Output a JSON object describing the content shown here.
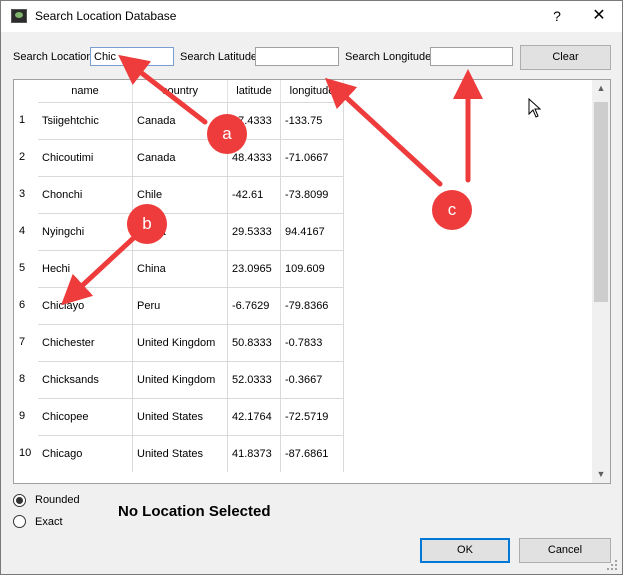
{
  "window": {
    "title": "Search Location Database",
    "help_glyph": "?",
    "close_glyph": "✕"
  },
  "search": {
    "location_label": "Search Location",
    "location_value": "Chic",
    "latitude_label": "Search Latitude",
    "latitude_value": "",
    "longitude_label": "Search Longitude",
    "longitude_value": "",
    "clear_label": "Clear"
  },
  "table": {
    "columns": [
      "name",
      "country",
      "latitude",
      "longitude"
    ],
    "rows": [
      {
        "n": "1",
        "name": "Tsiigehtchic",
        "country": "Canada",
        "latitude": "67.4333",
        "longitude": "-133.75"
      },
      {
        "n": "2",
        "name": "Chicoutimi",
        "country": "Canada",
        "latitude": "48.4333",
        "longitude": "-71.0667"
      },
      {
        "n": "3",
        "name": "Chonchi",
        "country": "Chile",
        "latitude": "-42.61",
        "longitude": "-73.8099"
      },
      {
        "n": "4",
        "name": "Nyingchi",
        "country": "China",
        "latitude": "29.5333",
        "longitude": "94.4167"
      },
      {
        "n": "5",
        "name": "Hechi",
        "country": "China",
        "latitude": "23.0965",
        "longitude": "109.609"
      },
      {
        "n": "6",
        "name": "Chiclayo",
        "country": "Peru",
        "latitude": "-6.7629",
        "longitude": "-79.8366"
      },
      {
        "n": "7",
        "name": "Chichester",
        "country": "United Kingdom",
        "latitude": "50.8333",
        "longitude": "-0.7833"
      },
      {
        "n": "8",
        "name": "Chicksands",
        "country": "United Kingdom",
        "latitude": "52.0333",
        "longitude": "-0.3667"
      },
      {
        "n": "9",
        "name": "Chicopee",
        "country": "United States",
        "latitude": "42.1764",
        "longitude": "-72.5719"
      },
      {
        "n": "10",
        "name": "Chicago",
        "country": "United States",
        "latitude": "41.8373",
        "longitude": "-87.6861"
      }
    ]
  },
  "mode": {
    "rounded_label": "Rounded",
    "exact_label": "Exact",
    "selected": "Rounded"
  },
  "status_text": "No Location Selected",
  "buttons": {
    "ok": "OK",
    "cancel": "Cancel"
  },
  "annotations": {
    "a": "a",
    "b": "b",
    "c": "c",
    "color": "#ee3b3b"
  }
}
